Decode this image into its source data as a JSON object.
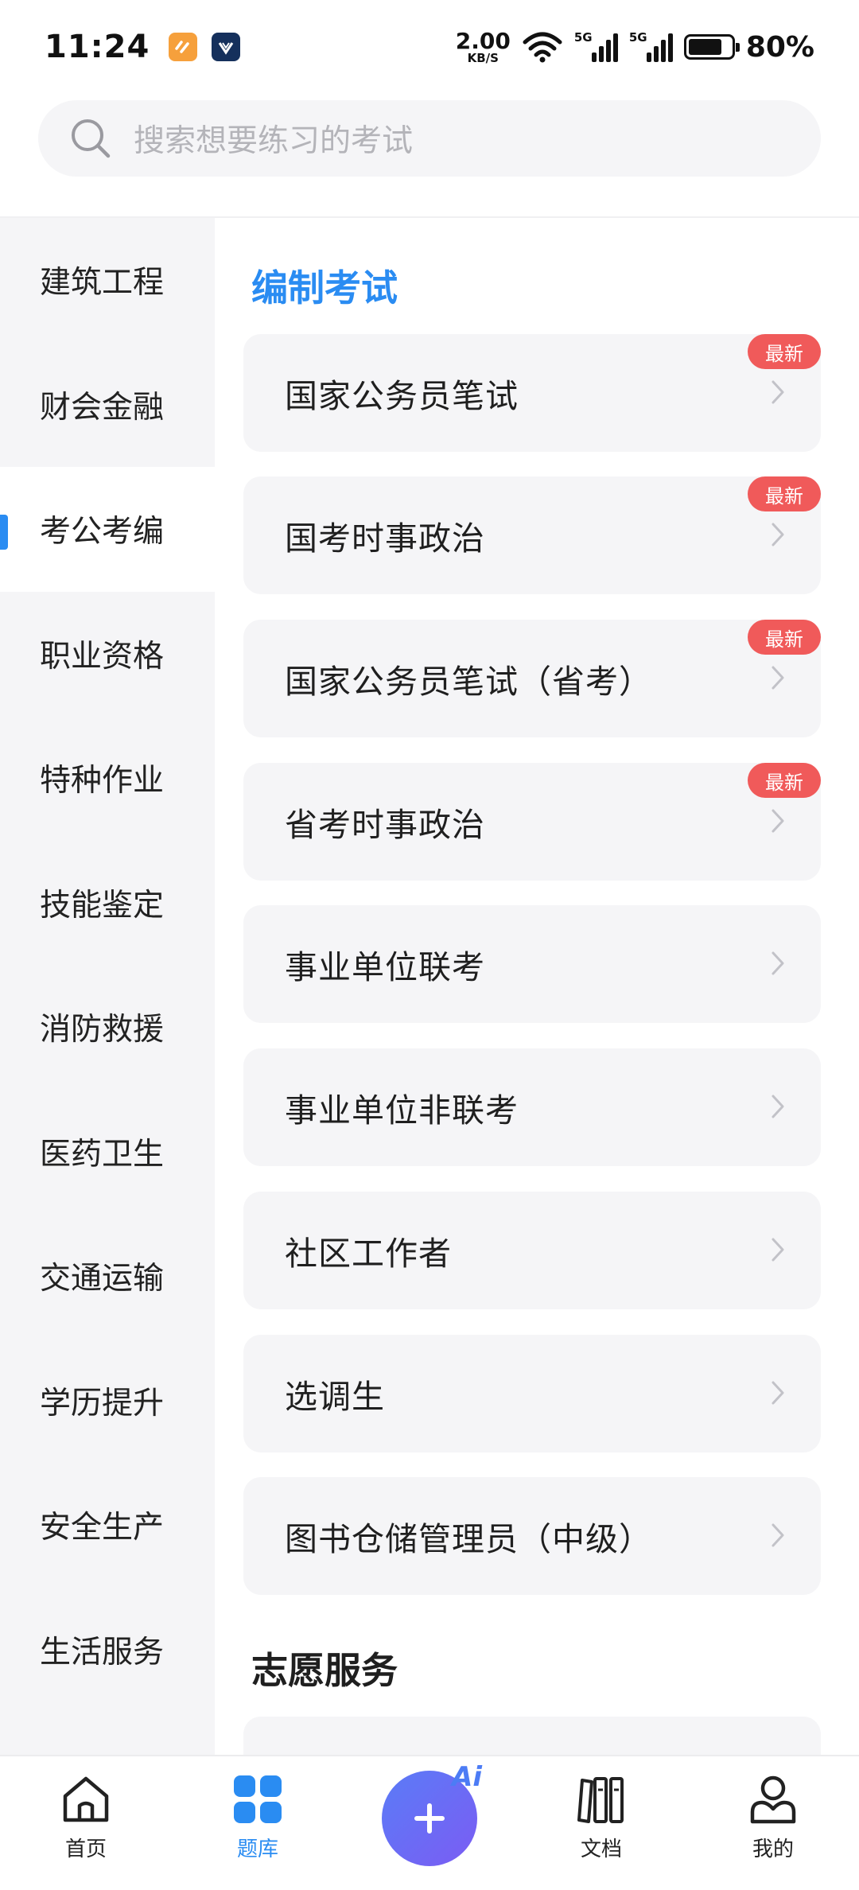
{
  "status_bar": {
    "time": "11:24",
    "net_speed_value": "2.00",
    "net_speed_unit": "KB/S",
    "signal_1": "5G",
    "signal_2": "5G",
    "battery": "80%"
  },
  "search": {
    "placeholder": "搜索想要练习的考试"
  },
  "sidebar": {
    "items": [
      {
        "label": "建筑工程"
      },
      {
        "label": "财会金融"
      },
      {
        "label": "考公考编"
      },
      {
        "label": "职业资格"
      },
      {
        "label": "特种作业"
      },
      {
        "label": "技能鉴定"
      },
      {
        "label": "消防救援"
      },
      {
        "label": "医药卫生"
      },
      {
        "label": "交通运输"
      },
      {
        "label": "学历提升"
      },
      {
        "label": "安全生产"
      },
      {
        "label": "生活服务"
      }
    ]
  },
  "content": {
    "section_1_title": "编制考试",
    "cards": [
      {
        "label": "国家公务员笔试",
        "badge": "最新"
      },
      {
        "label": "国考时事政治",
        "badge": "最新"
      },
      {
        "label": "国家公务员笔试（省考）",
        "badge": "最新"
      },
      {
        "label": "省考时事政治",
        "badge": "最新"
      },
      {
        "label": "事业单位联考"
      },
      {
        "label": "事业单位非联考"
      },
      {
        "label": "社区工作者"
      },
      {
        "label": "选调生"
      },
      {
        "label": "图书仓储管理员（中级）"
      }
    ],
    "section_2_title": "志愿服务"
  },
  "bottom_nav": {
    "home": "首页",
    "question_bank": "题库",
    "ai_tag": "Ai",
    "docs": "文档",
    "mine": "我的"
  },
  "colors": {
    "accent": "#2a8cf2",
    "badge": "#f05a5a",
    "card_bg": "#f5f5f7"
  }
}
